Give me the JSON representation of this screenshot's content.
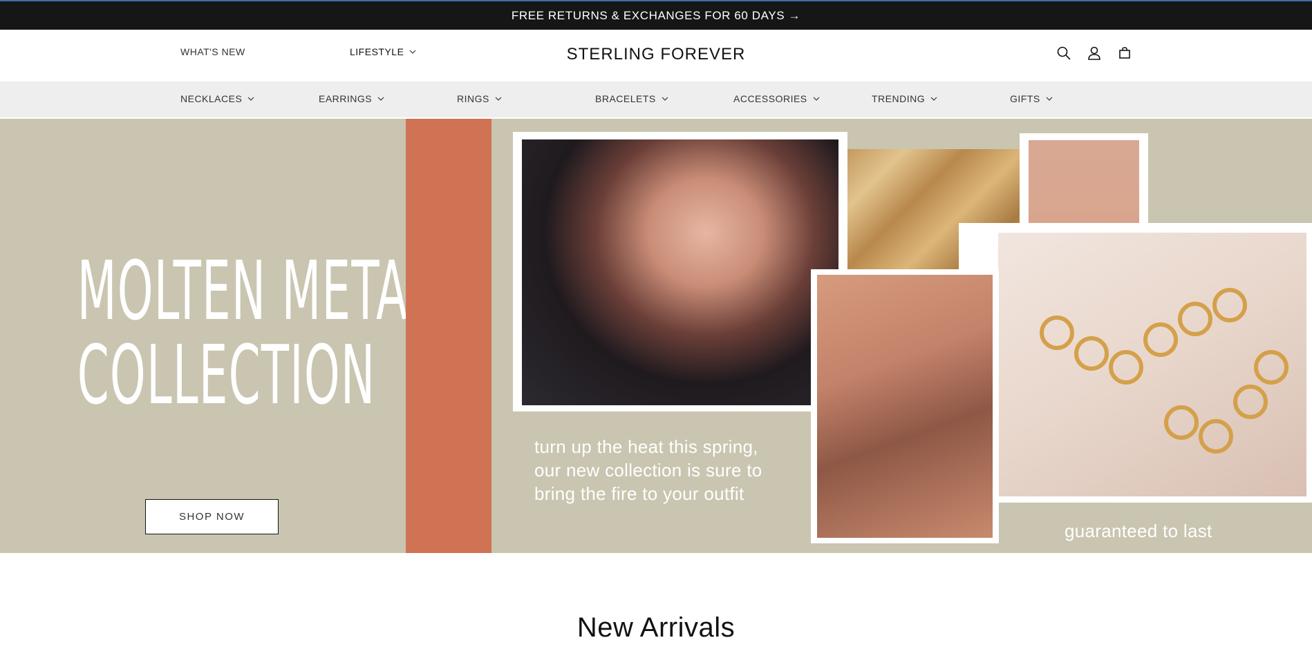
{
  "announcement": {
    "text": "FREE RETURNS & EXCHANGES FOR 60 DAYS →"
  },
  "header": {
    "whats_new": "WHAT'S NEW",
    "lifestyle": "LIFESTYLE",
    "logo": "STERLING FOREVER",
    "icons": [
      "search-icon",
      "account-icon",
      "cart-icon"
    ]
  },
  "categories": [
    {
      "label": "NECKLACES"
    },
    {
      "label": "EARRINGS"
    },
    {
      "label": "RINGS"
    },
    {
      "label": "BRACELETS"
    },
    {
      "label": "ACCESSORIES"
    },
    {
      "label": "TRENDING"
    },
    {
      "label": "GIFTS"
    }
  ],
  "hero": {
    "title_line1": "MOLTEN METAL",
    "title_line2": "COLLECTION",
    "cta": "SHOP NOW",
    "caption_line1": "turn up the heat this spring,",
    "caption_line2": "our new collection is sure to",
    "caption_line3": "bring the fire to your outfit",
    "caption_right": "guaranteed to last",
    "colors": {
      "background": "#c9c5b0",
      "accent_bar": "#d07254"
    }
  },
  "section": {
    "title": "New Arrivals"
  }
}
